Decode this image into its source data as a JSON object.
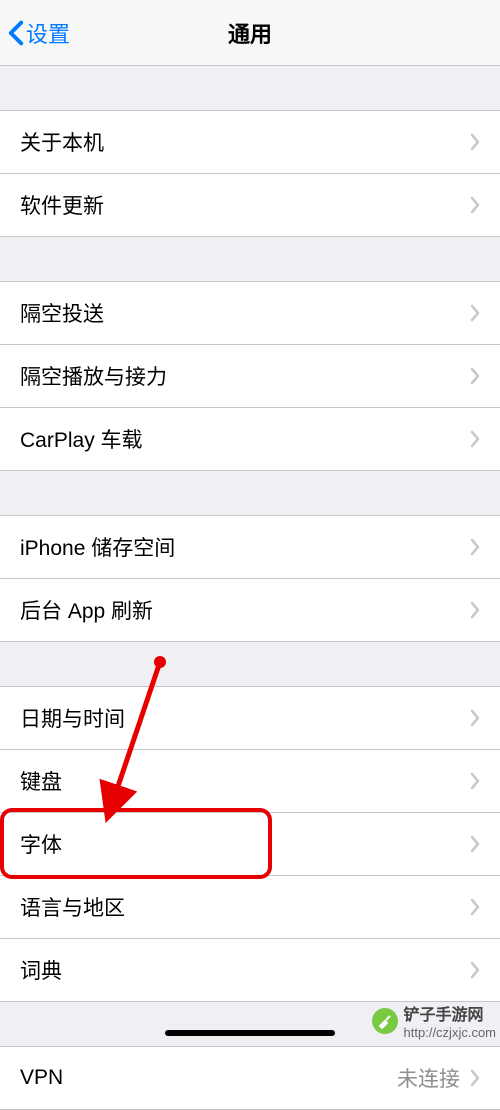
{
  "header": {
    "back_label": "设置",
    "title": "通用"
  },
  "sections": [
    {
      "rows": [
        {
          "label": "关于本机"
        },
        {
          "label": "软件更新"
        }
      ]
    },
    {
      "rows": [
        {
          "label": "隔空投送"
        },
        {
          "label": "隔空播放与接力"
        },
        {
          "label": "CarPlay 车载"
        }
      ]
    },
    {
      "rows": [
        {
          "label": "iPhone 储存空间"
        },
        {
          "label": "后台 App 刷新"
        }
      ]
    },
    {
      "rows": [
        {
          "label": "日期与时间"
        },
        {
          "label": "键盘"
        },
        {
          "label": "字体"
        },
        {
          "label": "语言与地区"
        },
        {
          "label": "词典"
        }
      ]
    },
    {
      "rows": [
        {
          "label": "VPN",
          "value": "未连接"
        }
      ]
    }
  ],
  "watermark": {
    "name": "铲子手游网",
    "url": "http://czjxjc.com"
  }
}
